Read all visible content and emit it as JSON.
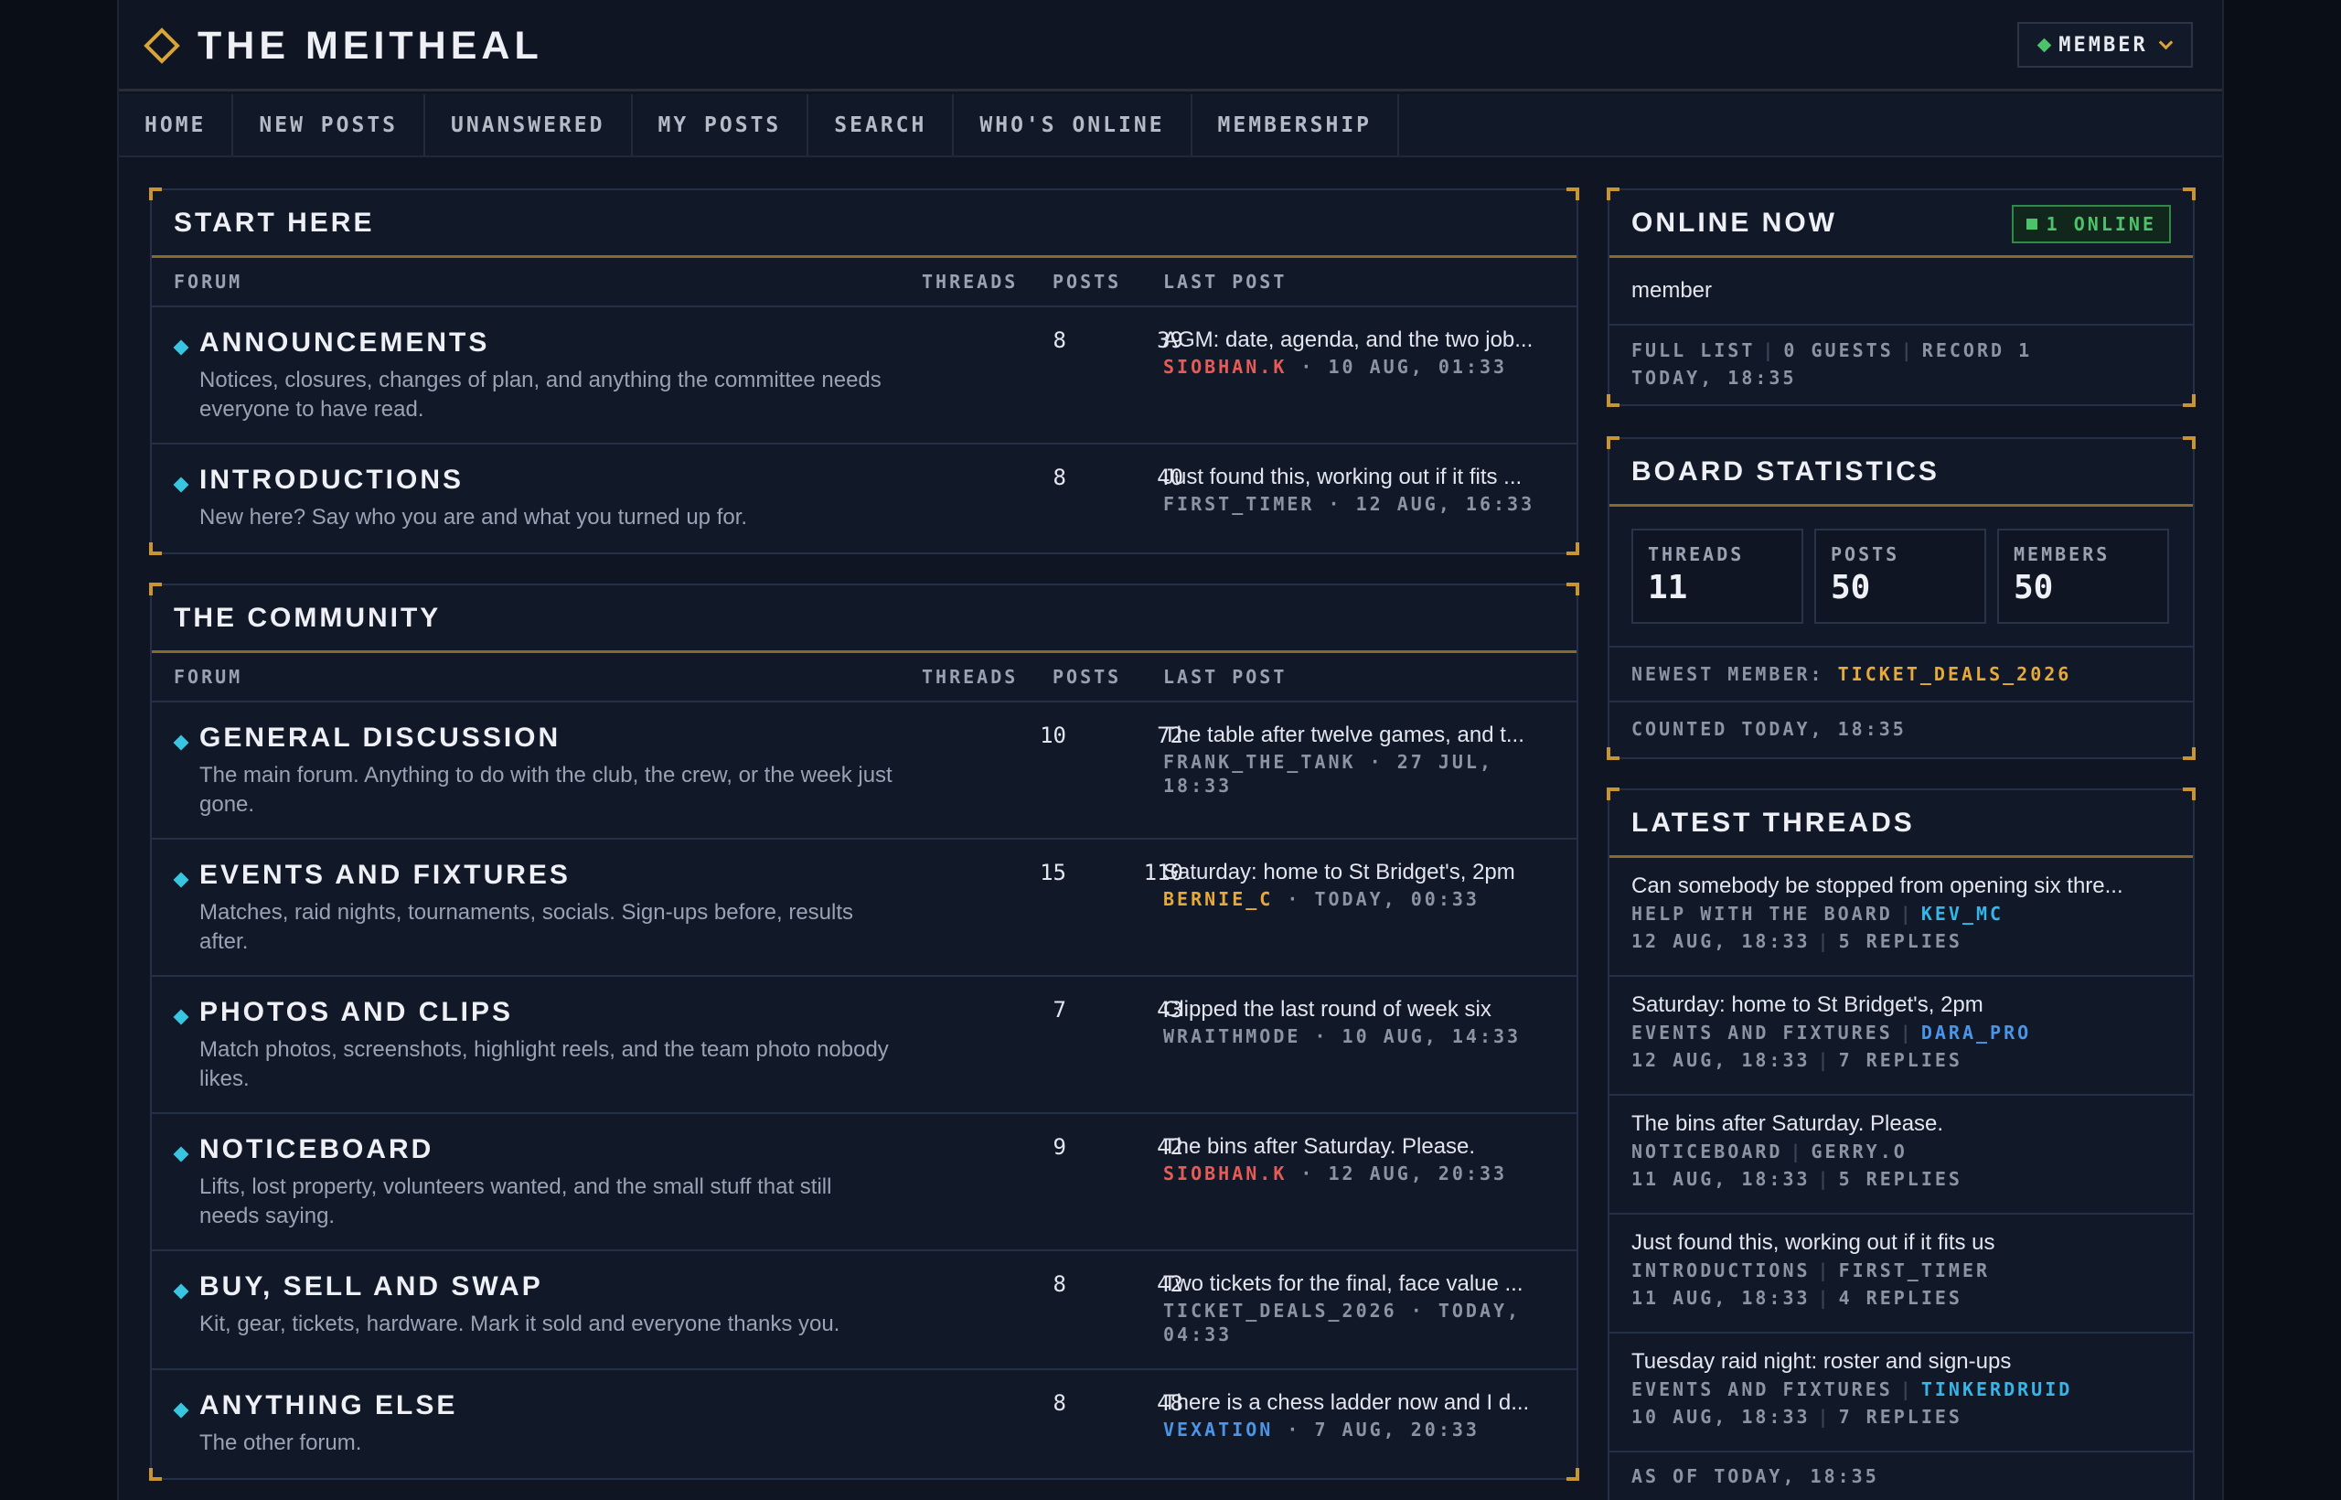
{
  "site": {
    "title": "THE MEITHEAL",
    "member_label": "MEMBER"
  },
  "nav": [
    "HOME",
    "NEW POSTS",
    "UNANSWERED",
    "MY POSTS",
    "SEARCH",
    "WHO'S ONLINE",
    "MEMBERSHIP"
  ],
  "columns": {
    "forum": "FORUM",
    "threads": "THREADS",
    "posts": "POSTS",
    "last_post": "LAST POST"
  },
  "sections": [
    {
      "title": "START HERE",
      "forums": [
        {
          "name": "ANNOUNCEMENTS",
          "desc": "Notices, closures, changes of plan, and anything the committee needs everyone to have read.",
          "threads": "8",
          "posts": "39",
          "last_title": "AGM: date, agenda, and the two job...",
          "last_user": "SIOBHAN.K",
          "last_time": " · 10 AUG, 01:33"
        },
        {
          "name": "INTRODUCTIONS",
          "desc": "New here? Say who you are and what you turned up for.",
          "threads": "8",
          "posts": "40",
          "last_title": "Just found this, working out if it fits ...",
          "last_user": "FIRST_TIMER",
          "last_time": " · 12 AUG, 16:33"
        }
      ]
    },
    {
      "title": "THE COMMUNITY",
      "forums": [
        {
          "name": "GENERAL DISCUSSION",
          "desc": "The main forum. Anything to do with the club, the crew, or the week just gone.",
          "threads": "10",
          "posts": "72",
          "last_title": "The table after twelve games, and t...",
          "last_user": "FRANK_THE_TANK",
          "last_time": " · 27 JUL, 18:33"
        },
        {
          "name": "EVENTS AND FIXTURES",
          "desc": "Matches, raid nights, tournaments, socials. Sign-ups before, results after.",
          "threads": "15",
          "posts": "110",
          "last_title": "Saturday: home to St Bridget's, 2pm",
          "last_user": "BERNIE_C",
          "last_time": " · TODAY, 00:33"
        },
        {
          "name": "PHOTOS AND CLIPS",
          "desc": "Match photos, screenshots, highlight reels, and the team photo nobody likes.",
          "threads": "7",
          "posts": "43",
          "last_title": "Clipped the last round of week six",
          "last_user": "WRAITHMODE",
          "last_time": " · 10 AUG, 14:33"
        },
        {
          "name": "NOTICEBOARD",
          "desc": "Lifts, lost property, volunteers wanted, and the small stuff that still needs saying.",
          "threads": "9",
          "posts": "42",
          "last_title": "The bins after Saturday. Please.",
          "last_user": "SIOBHAN.K",
          "last_time": " · 12 AUG, 20:33"
        },
        {
          "name": "BUY, SELL AND SWAP",
          "desc": "Kit, gear, tickets, hardware. Mark it sold and everyone thanks you.",
          "threads": "8",
          "posts": "42",
          "last_title": "Two tickets for the final, face value ...",
          "last_user": "TICKET_DEALS_2026",
          "last_time": " · TODAY, 04:33"
        },
        {
          "name": "ANYTHING ELSE",
          "desc": "The other forum.",
          "threads": "8",
          "posts": "48",
          "last_title": "There is a chess ladder now and I d...",
          "last_user": "VEXATION",
          "last_time": " · 7 AUG, 20:33"
        }
      ]
    }
  ],
  "online": {
    "title": "ONLINE NOW",
    "badge": "1 ONLINE",
    "user": "member",
    "full_list": "FULL LIST",
    "guests": "0 GUESTS",
    "record": "RECORD 1",
    "record_time": "TODAY, 18:35"
  },
  "stats": {
    "title": "BOARD STATISTICS",
    "threads_label": "THREADS",
    "threads": "11",
    "posts_label": "POSTS",
    "posts": "50",
    "members_label": "MEMBERS",
    "members": "50",
    "newest_label": "NEWEST MEMBER: ",
    "newest": "TICKET_DEALS_2026",
    "counted": "COUNTED TODAY, 18:35"
  },
  "latest": {
    "title": "LATEST THREADS",
    "items": [
      {
        "title": "Can somebody be stopped from opening six thre...",
        "forum": "HELP WITH THE BOARD",
        "user": "KEV_MC",
        "time": "12 AUG, 18:33",
        "replies": "5 REPLIES"
      },
      {
        "title": "Saturday: home to St Bridget's, 2pm",
        "forum": "EVENTS AND FIXTURES",
        "user": "DARA_PRO",
        "time": "12 AUG, 18:33",
        "replies": "7 REPLIES"
      },
      {
        "title": "The bins after Saturday. Please.",
        "forum": "NOTICEBOARD",
        "user": "GERRY.O",
        "time": "11 AUG, 18:33",
        "replies": "5 REPLIES"
      },
      {
        "title": "Just found this, working out if it fits us",
        "forum": "INTRODUCTIONS",
        "user": "FIRST_TIMER",
        "time": "11 AUG, 18:33",
        "replies": "4 REPLIES"
      },
      {
        "title": "Tuesday raid night: roster and sign-ups",
        "forum": "EVENTS AND FIXTURES",
        "user": "TINKERDRUID",
        "time": "10 AUG, 18:33",
        "replies": "7 REPLIES"
      }
    ],
    "as_of": "AS OF TODAY, 18:35"
  },
  "colors": {
    "accent_gold": "#d9a437",
    "forum_diamond": "#38c5e0",
    "online_green": "#4cc36b",
    "user_red": "#e85a55",
    "user_gold": "#e6a93a",
    "user_blue": "#4b95e8"
  }
}
